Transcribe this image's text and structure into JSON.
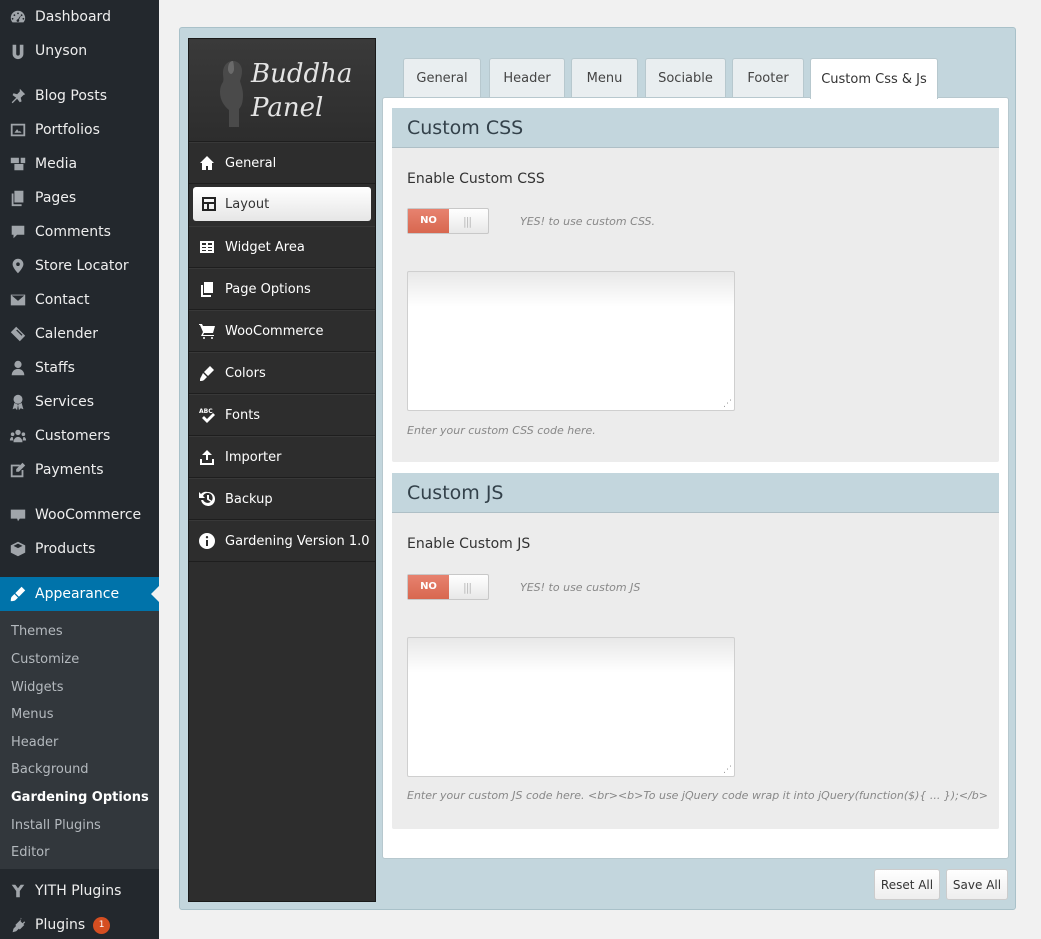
{
  "wp_menu": {
    "items": [
      {
        "label": "Dashboard",
        "icon": "dashboard-icon"
      },
      {
        "label": "Unyson",
        "icon": "unyson-icon"
      },
      {
        "label": "Blog Posts",
        "icon": "pin-icon"
      },
      {
        "label": "Portfolios",
        "icon": "portfolio-icon"
      },
      {
        "label": "Media",
        "icon": "media-icon"
      },
      {
        "label": "Pages",
        "icon": "pages-icon"
      },
      {
        "label": "Comments",
        "icon": "comments-icon"
      },
      {
        "label": "Store Locator",
        "icon": "location-pin-icon"
      },
      {
        "label": "Contact",
        "icon": "envelope-icon"
      },
      {
        "label": "Calender",
        "icon": "calendar-icon"
      },
      {
        "label": "Staffs",
        "icon": "user-icon"
      },
      {
        "label": "Services",
        "icon": "award-icon"
      },
      {
        "label": "Customers",
        "icon": "groups-icon"
      },
      {
        "label": "Payments",
        "icon": "edit-icon"
      },
      {
        "label": "WooCommerce",
        "icon": "woo-icon"
      },
      {
        "label": "Products",
        "icon": "products-icon"
      },
      {
        "label": "Appearance",
        "icon": "brush-icon"
      },
      {
        "label": "YITH Plugins",
        "icon": "yith-icon"
      },
      {
        "label": "Plugins",
        "icon": "plug-icon",
        "badge": "1"
      }
    ],
    "submenu": [
      "Themes",
      "Customize",
      "Widgets",
      "Menus",
      "Header",
      "Background",
      "Gardening Options",
      "Install Plugins",
      "Editor"
    ]
  },
  "panel": {
    "logo_line1": "Buddha",
    "logo_line2": "Panel",
    "nav": [
      {
        "label": "General",
        "icon": "home-icon"
      },
      {
        "label": "Layout",
        "icon": "layout-icon"
      },
      {
        "label": "Widget Area",
        "icon": "widget-icon"
      },
      {
        "label": "Page Options",
        "icon": "copy-icon"
      },
      {
        "label": "WooCommerce",
        "icon": "cart-icon"
      },
      {
        "label": "Colors",
        "icon": "brush-icon"
      },
      {
        "label": "Fonts",
        "icon": "spellcheck-icon"
      },
      {
        "label": "Importer",
        "icon": "upload-icon"
      },
      {
        "label": "Backup",
        "icon": "history-icon"
      },
      {
        "label": "Gardening Version 1.0",
        "icon": "info-icon"
      }
    ]
  },
  "tabs": [
    "General",
    "Header",
    "Menu",
    "Sociable",
    "Footer",
    "Custom Css & Js"
  ],
  "css_section": {
    "title": "Custom CSS",
    "label": "Enable Custom CSS",
    "toggle": "NO",
    "toggle_hint": "YES! to use custom CSS.",
    "value": "",
    "help": "Enter your custom CSS code here."
  },
  "js_section": {
    "title": "Custom JS",
    "label": "Enable Custom JS",
    "toggle": "NO",
    "toggle_hint": "YES! to use custom JS",
    "value": "",
    "help": "Enter your custom JS code here. <br><b>To use jQuery code wrap it into jQuery(function($){ ... });</b>"
  },
  "buttons": {
    "reset": "Reset All",
    "save": "Save All"
  },
  "colors": {
    "wp_sidebar": "#23282d",
    "wp_active": "#0073aa",
    "panel_bg": "#c3d6dd",
    "toggle_no": "#d8674f"
  }
}
